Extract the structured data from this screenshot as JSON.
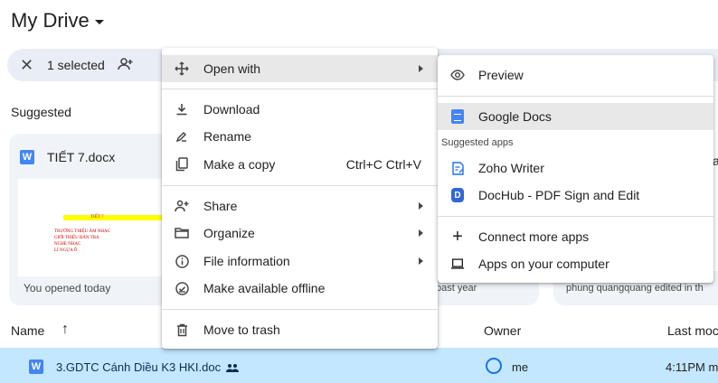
{
  "header": {
    "title": "My Drive"
  },
  "selection_bar": {
    "count_label": "1 selected"
  },
  "section": {
    "suggested_label": "Suggested"
  },
  "cards": [
    {
      "filename": "TIẾT 7.docx",
      "thumb_line1": "TIẾT 7",
      "thumb_line2": "TRƯỜNG THIỆU ÂM NHẠC\nGIỚI THIỆU BẢN TRA\nNGHE NHẠC\nLÍ NGỰA Ô",
      "footer": "You opened today"
    },
    {
      "footer": "past year"
    },
    {
      "footer": "phung quangquang edited in th",
      "partial_title": "a"
    }
  ],
  "columns": {
    "name": "Name",
    "sort_arrow": "↑",
    "owner": "Owner",
    "last_modified": "Last moc"
  },
  "file_row": {
    "name": "3.GDTC Cánh Diều K3 HKI.doc",
    "owner": "me",
    "modified": "4:11PM m"
  },
  "context_menu": {
    "open_with": "Open with",
    "download": "Download",
    "rename": "Rename",
    "make_copy": "Make a copy",
    "make_copy_shortcut": "Ctrl+C Ctrl+V",
    "share": "Share",
    "organize": "Organize",
    "file_information": "File information",
    "offline": "Make available offline",
    "trash": "Move to trash"
  },
  "open_with_menu": {
    "preview": "Preview",
    "google_docs": "Google Docs",
    "suggested_apps": "Suggested apps",
    "zoho": "Zoho Writer",
    "dochub": "DocHub - PDF Sign and Edit",
    "connect": "Connect more apps",
    "computer": "Apps on your computer"
  },
  "colors": {
    "selection_bar": "#e9eef6",
    "selected_row": "#c2e7ff",
    "docs_blue": "#4285f4",
    "menu_highlight": "#e8e8e8"
  }
}
